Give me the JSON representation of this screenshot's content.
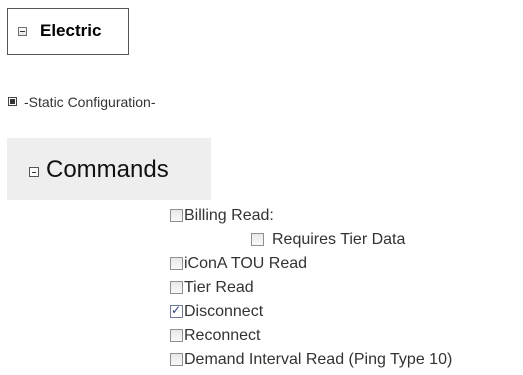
{
  "electric": {
    "title": "Electric"
  },
  "static_config": {
    "label": "-Static Configuration-"
  },
  "commands": {
    "title": "Commands",
    "items": [
      {
        "label": "Billing Read:",
        "checked": false
      },
      {
        "label": "Requires Tier Data",
        "checked": false
      },
      {
        "label": "iConA TOU Read",
        "checked": false
      },
      {
        "label": "Tier Read",
        "checked": false
      },
      {
        "label": "Disconnect",
        "checked": true
      },
      {
        "label": "Reconnect",
        "checked": false
      },
      {
        "label": "Demand Interval Read (Ping Type 10)",
        "checked": false
      }
    ]
  }
}
